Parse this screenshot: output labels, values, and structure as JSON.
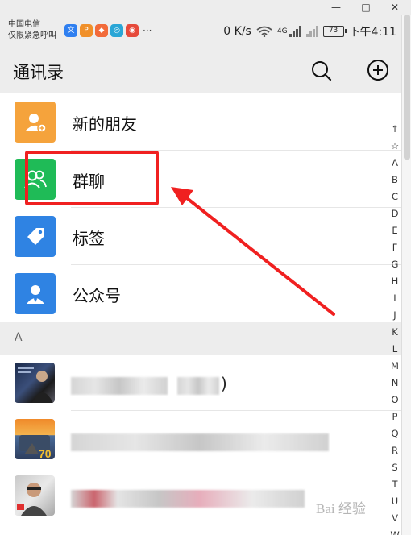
{
  "window": {
    "minimize": "—",
    "maximize": "□",
    "close": "✕"
  },
  "status": {
    "carrier_line1": "中国电信",
    "carrier_line2": "仅限紧急呼叫",
    "notif_icons": [
      {
        "name": "wen-app-icon",
        "glyph": "文",
        "color": "#2f7ff0"
      },
      {
        "name": "p-app-icon",
        "glyph": "P",
        "color": "#f0902a"
      },
      {
        "name": "orange-app-icon",
        "glyph": "◆",
        "color": "#f26b3a"
      },
      {
        "name": "cctv-app-icon",
        "glyph": "◎",
        "color": "#2aa6d6"
      },
      {
        "name": "weibo-app-icon",
        "glyph": "◉",
        "color": "#e64a3b"
      }
    ],
    "notif_more": "···",
    "speed": "0 K/s",
    "network": "4G",
    "battery": "73",
    "time": "下午4:11"
  },
  "header": {
    "title": "通讯录"
  },
  "menu_rows": [
    {
      "label": "新的朋友",
      "icon": "add-friend-icon",
      "color": "#f5a33c"
    },
    {
      "label": "群聊",
      "icon": "group-chat-icon",
      "color": "#1fbb57"
    },
    {
      "label": "标签",
      "icon": "tag-icon",
      "color": "#2f83e3"
    },
    {
      "label": "公众号",
      "icon": "official-account-icon",
      "color": "#2f83e3"
    }
  ],
  "section": {
    "letter": "A"
  },
  "contacts_tail": ")",
  "index": [
    "↑",
    "☆",
    "A",
    "B",
    "C",
    "D",
    "E",
    "F",
    "G",
    "H",
    "I",
    "J",
    "K",
    "L",
    "M",
    "N",
    "O",
    "P",
    "Q",
    "R",
    "S",
    "T",
    "U",
    "V",
    "W"
  ],
  "watermark": "Bai 经验"
}
